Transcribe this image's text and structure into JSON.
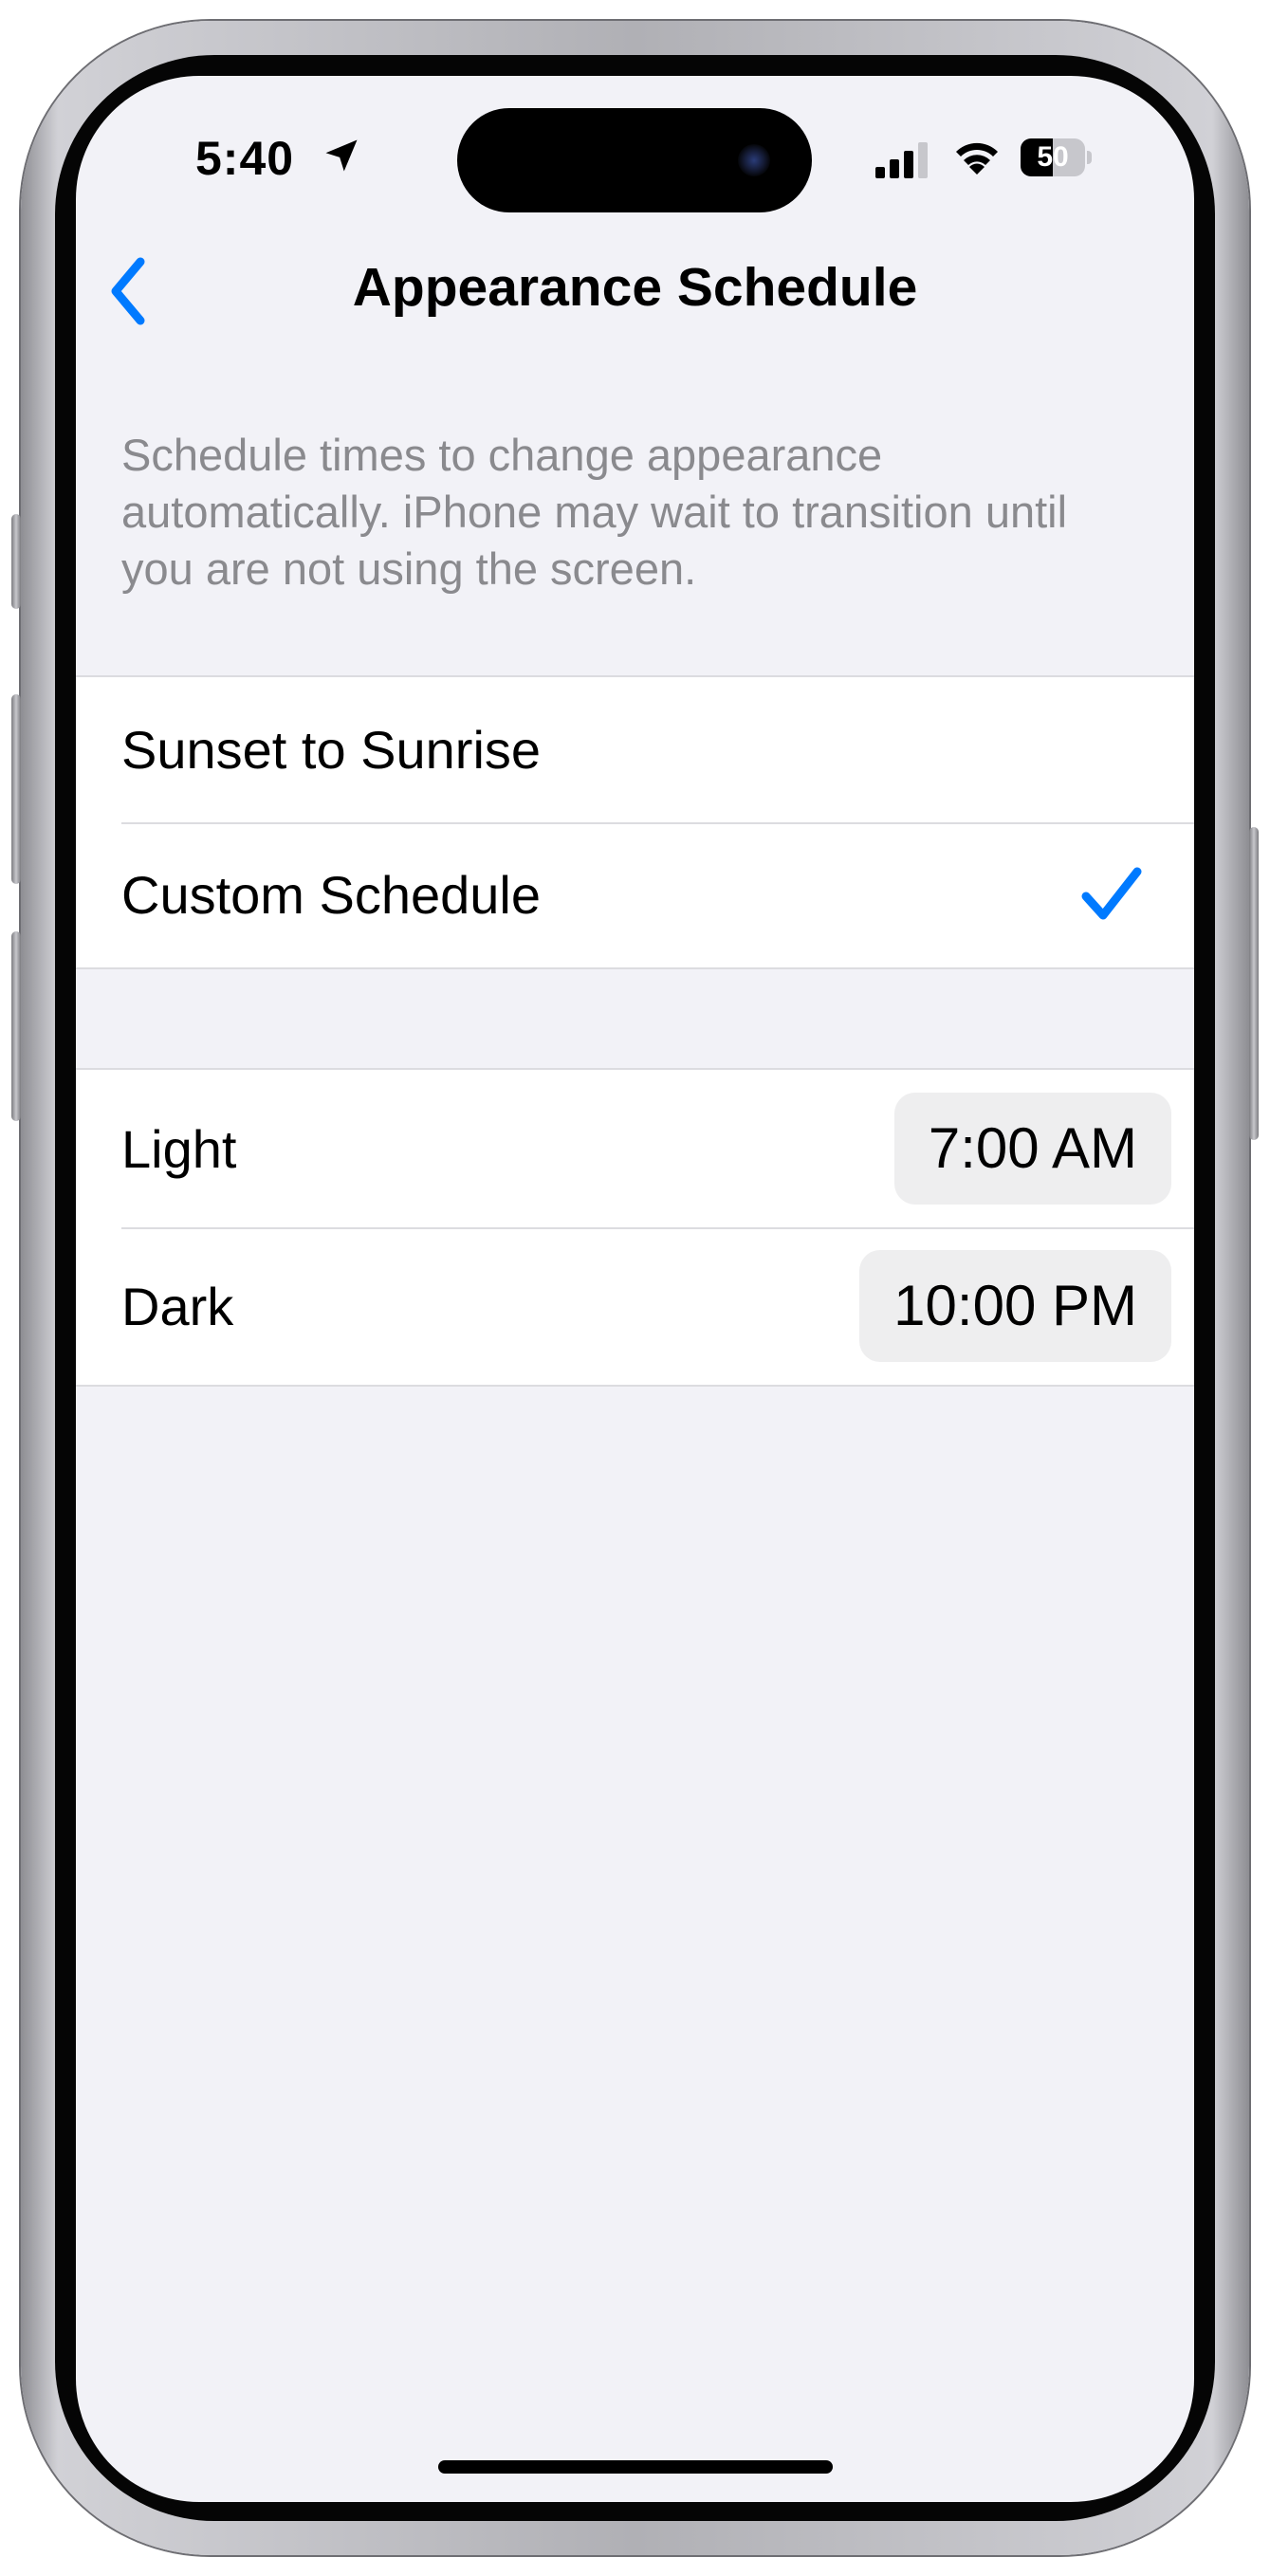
{
  "status_bar": {
    "time": "5:40",
    "battery_level": "50",
    "icons": [
      "location-arrow-icon",
      "cellular-signal-icon",
      "wifi-icon",
      "battery-icon"
    ]
  },
  "nav": {
    "back_icon": "chevron-left-icon",
    "title": "Appearance Schedule"
  },
  "description": "Schedule times to change appearance automatically. iPhone may wait to transition until you are not using the screen.",
  "schedule_options": [
    {
      "label": "Sunset to Sunrise",
      "selected": false
    },
    {
      "label": "Custom Schedule",
      "selected": true
    }
  ],
  "times": {
    "light": {
      "label": "Light",
      "value": "7:00 AM"
    },
    "dark": {
      "label": "Dark",
      "value": "10:00 PM"
    }
  },
  "colors": {
    "accent": "#007AFF",
    "background": "#F2F2F7",
    "secondary_text": "#8A8A8E",
    "pill_background": "#EEEEEF"
  }
}
